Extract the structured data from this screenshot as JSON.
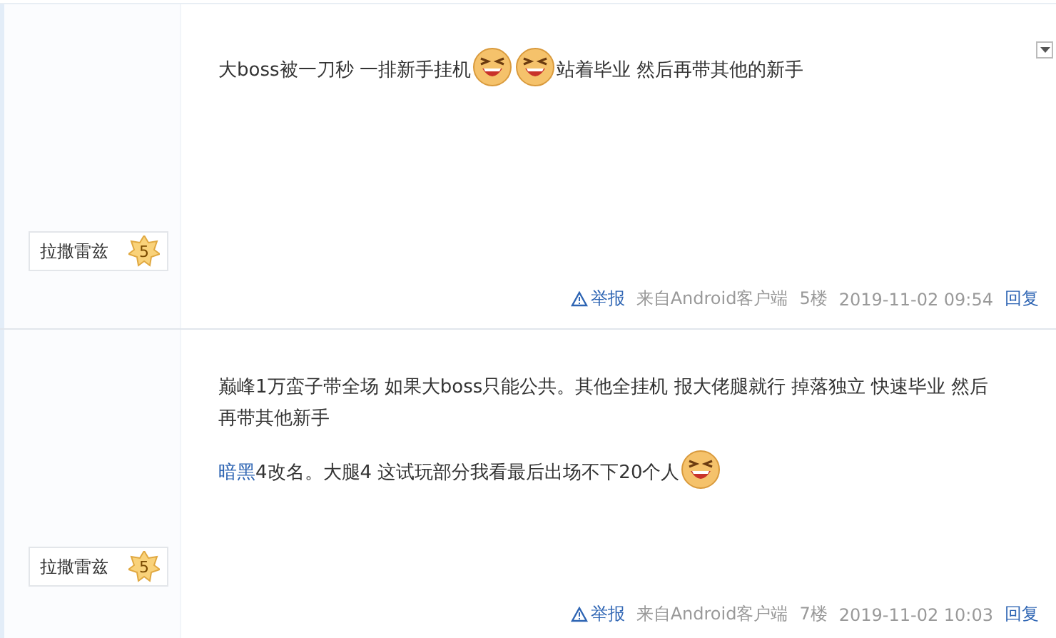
{
  "posts": [
    {
      "author": "拉撒雷兹",
      "level": "5",
      "has_menu": true,
      "paragraphs": [
        [
          {
            "kind": "text",
            "text": "大boss被一刀秒 一排新手挂机"
          },
          {
            "kind": "emoji"
          },
          {
            "kind": "emoji"
          },
          {
            "kind": "text",
            "text": "站着毕业 然后再带其他的新手"
          }
        ]
      ],
      "footer": {
        "report": "举报",
        "source": "来自Android客户端",
        "floor": "5楼",
        "time": "2019-11-02 09:54",
        "reply": "回复"
      }
    },
    {
      "author": "拉撒雷兹",
      "level": "5",
      "has_menu": false,
      "paragraphs": [
        [
          {
            "kind": "text",
            "text": "巅峰1万蛮子带全场 如果大boss只能公共。其他全挂机 报大佬腿就行 掉落独立 快速毕业 然后再带其他新手"
          }
        ],
        [
          {
            "kind": "link",
            "text": "暗黑"
          },
          {
            "kind": "text",
            "text": "4改名。大腿4 这试玩部分我看最后出场不下20个人"
          },
          {
            "kind": "emoji"
          }
        ]
      ],
      "footer": {
        "report": "举报",
        "source": "来自Android客户端",
        "floor": "7楼",
        "time": "2019-11-02 10:03",
        "reply": "回复"
      }
    }
  ]
}
